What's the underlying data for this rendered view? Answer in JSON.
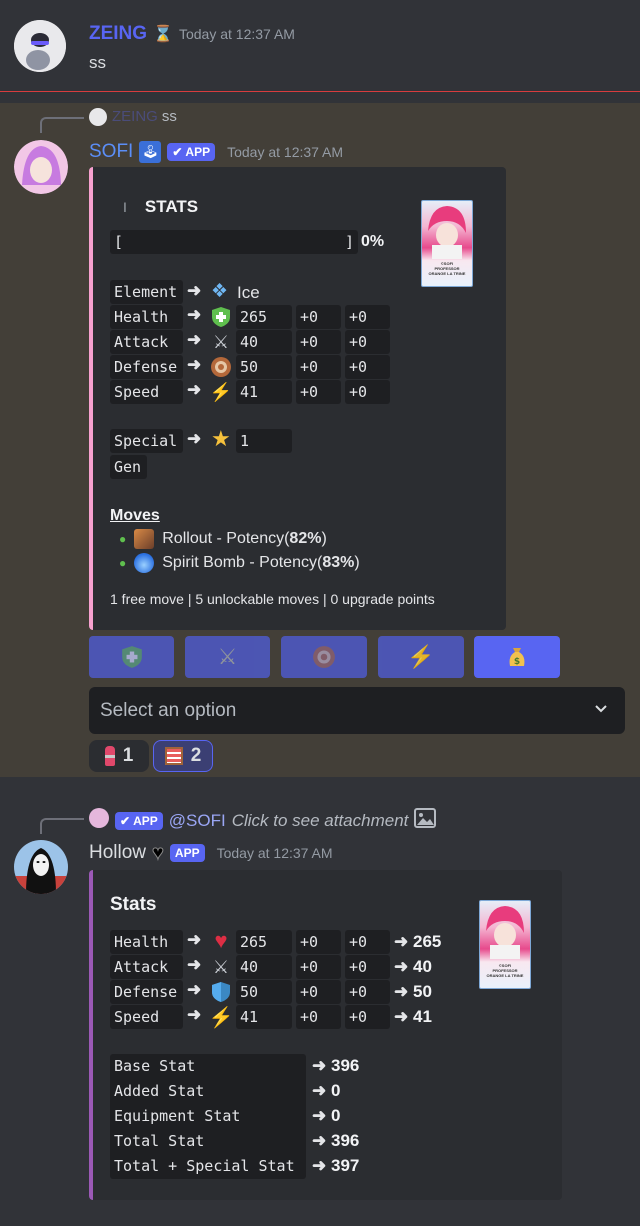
{
  "msg1": {
    "author": "ZEING",
    "author_color": "#5865f2",
    "timestamp": "Today at 12:37 AM",
    "text": "ss"
  },
  "msg2": {
    "reply_text": "ss",
    "author": "SOFI",
    "author_color": "#5b8ef7",
    "badge": "APP",
    "timestamp": "Today at 12:37 AM",
    "embed": {
      "accent": "#f7a1cf",
      "title_prefix": "I",
      "title": "STATS",
      "progress_open": "[",
      "progress_close": "]",
      "progress_percent": "0%",
      "element_label": "Element",
      "element_value": "Ice",
      "rows": [
        {
          "label": "Health",
          "value": "265",
          "plus1": "+0",
          "plus2": "+0",
          "icon": "health-shield-icon"
        },
        {
          "label": "Attack",
          "value": "40",
          "plus1": "+0",
          "plus2": "+0",
          "icon": "crossed-swords-icon"
        },
        {
          "label": "Defense",
          "value": "50",
          "plus1": "+0",
          "plus2": "+0",
          "icon": "shield-target-icon"
        },
        {
          "label": "Speed",
          "value": "41",
          "plus1": "+0",
          "plus2": "+0",
          "icon": "lightning-icon"
        }
      ],
      "special_label": "Special",
      "special_label_2": "Gen",
      "special_value": "1",
      "moves_title": "Moves",
      "moves": [
        {
          "name": "Rollout - Potency(",
          "pct": "82%",
          "tail": ")",
          "icon": "rollout-icon"
        },
        {
          "name": "Spirit Bomb - Potency(",
          "pct": "83%",
          "tail": ")",
          "icon": "spirit-bomb-icon"
        }
      ],
      "footer": "1 free move | 5 unlockable moves | 0 upgrade points"
    },
    "buttons": [
      "health-shield-icon",
      "crossed-swords-icon",
      "shield-target-icon",
      "lightning-icon",
      "money-bag-icon"
    ],
    "select_placeholder": "Select an option",
    "reactions": [
      {
        "icon": "lipstick-icon",
        "count": "1"
      },
      {
        "icon": "abacus-icon",
        "count": "2"
      }
    ]
  },
  "msg3": {
    "reply_mention": "@SOFI",
    "reply_text": "Click to see attachment",
    "reply_badge": "APP",
    "author": "Hollow",
    "badge": "APP",
    "timestamp": "Today at 12:37 AM",
    "embed": {
      "accent": "#9b59b6",
      "title": "Stats",
      "rows": [
        {
          "label": "Health",
          "value": "265",
          "plus1": "+0",
          "plus2": "+0",
          "total": "265",
          "icon": "heart-icon"
        },
        {
          "label": "Attack",
          "value": "40",
          "plus1": "+0",
          "plus2": "+0",
          "total": "40",
          "icon": "crossed-swords-icon"
        },
        {
          "label": "Defense",
          "value": "50",
          "plus1": "+0",
          "plus2": "+0",
          "total": "50",
          "icon": "blue-shield-icon"
        },
        {
          "label": "Speed",
          "value": "41",
          "plus1": "+0",
          "plus2": "+0",
          "total": "41",
          "icon": "lightning-icon"
        }
      ],
      "summary": [
        {
          "label": "Base Stat",
          "value": "396"
        },
        {
          "label": "Added Stat",
          "value": "0"
        },
        {
          "label": "Equipment Stat",
          "value": "0"
        },
        {
          "label": "Total Stat",
          "value": "396"
        },
        {
          "label": "Total + Special Stat",
          "value": "397"
        }
      ]
    }
  },
  "card_image": {
    "line1": "©SOFI",
    "line2": "PROFESSOR",
    "line3": "ORANGE LA TRINE"
  }
}
